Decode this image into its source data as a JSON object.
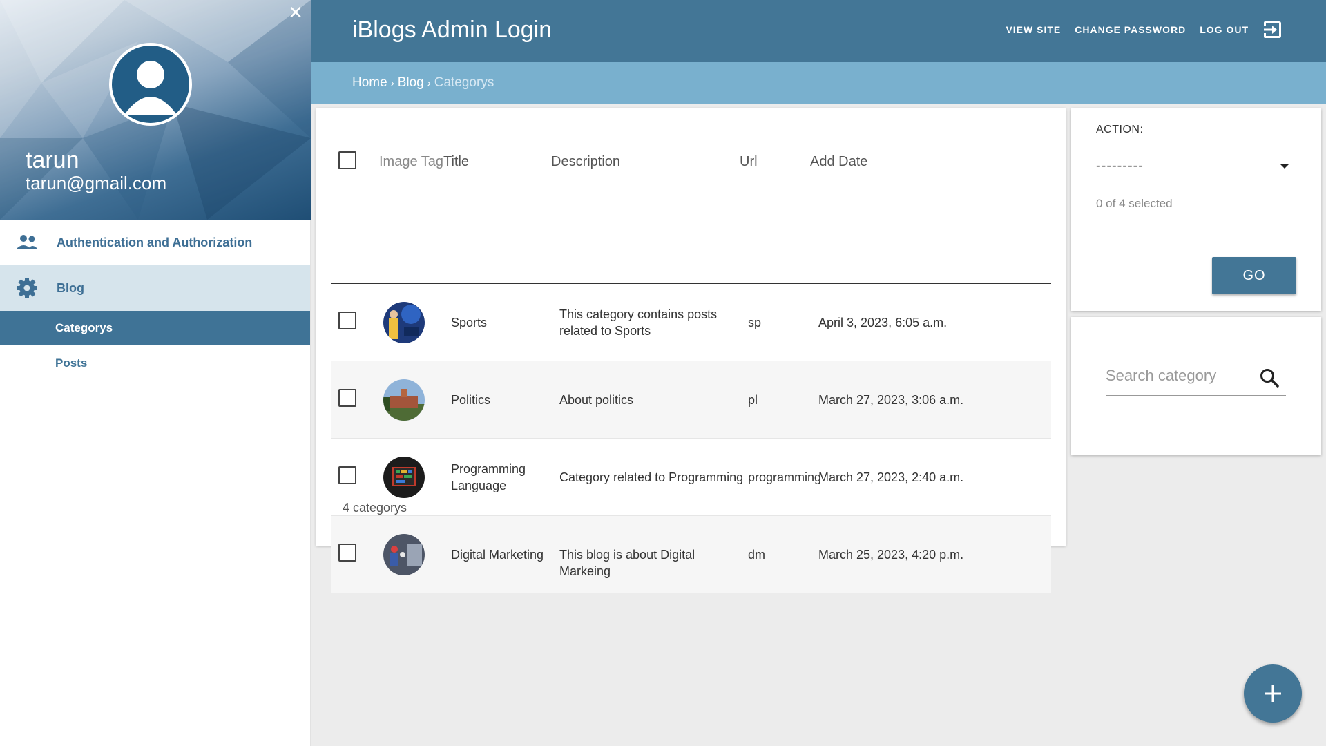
{
  "sidebar": {
    "user": {
      "name": "tarun",
      "email": "tarun@gmail.com"
    },
    "apps": [
      {
        "label": "Authentication and Authorization",
        "icon": "people-icon"
      },
      {
        "label": "Blog",
        "icon": "gear-icon",
        "models": [
          {
            "label": "Categorys",
            "active": true
          },
          {
            "label": "Posts",
            "active": false
          }
        ]
      }
    ]
  },
  "header": {
    "title": "iBlogs Admin Login",
    "links": {
      "view_site": "VIEW SITE",
      "change_password": "CHANGE PASSWORD",
      "log_out": "LOG OUT"
    }
  },
  "breadcrumbs": {
    "home": "Home",
    "separator": "›",
    "app": "Blog",
    "current": "Categorys"
  },
  "table": {
    "columns": [
      "Image Tag",
      "Title",
      "Description",
      "Url",
      "Add Date"
    ],
    "rows": [
      {
        "title": "Sports",
        "description": "This category contains posts related to Sports",
        "url": "sp",
        "add_date": "April 3, 2023, 6:05 a.m."
      },
      {
        "title": "Politics",
        "description": "About politics",
        "url": "pl",
        "add_date": "March 27, 2023, 3:06 a.m."
      },
      {
        "title": "Programming Language",
        "description": "Category related to Programming",
        "url": "programming",
        "add_date": "March 27, 2023, 2:40 a.m."
      },
      {
        "title": "Digital Marketing",
        "description": "This blog is about Digital Markeing",
        "url": "dm",
        "add_date": "March 25, 2023, 4:20 p.m."
      }
    ],
    "count_label": "4 categorys"
  },
  "actions": {
    "label": "ACTION:",
    "selected_value": "---------",
    "counter": "0 of 4 selected",
    "go_label": "GO"
  },
  "search": {
    "placeholder": "Search category"
  },
  "colors": {
    "primary": "#437696",
    "breadcrumb": "#79b0ce",
    "active_nav": "#3f7396",
    "nav_highlight": "#d6e4ec"
  }
}
